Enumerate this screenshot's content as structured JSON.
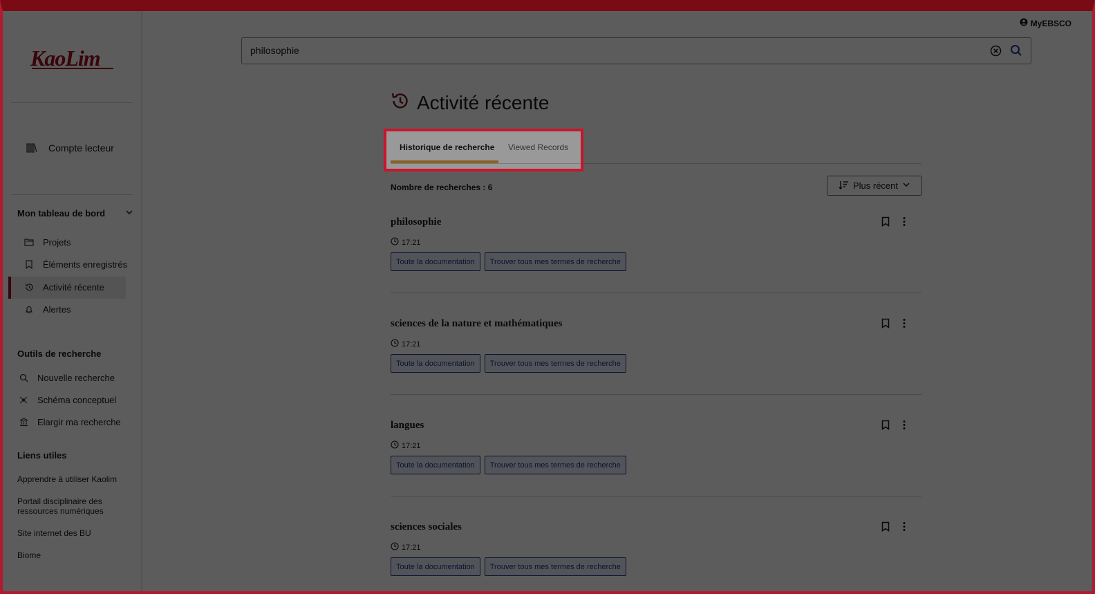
{
  "header": {
    "account_link": "MyEBSCO",
    "search_value": "philosophie"
  },
  "sidebar": {
    "logo_text": "KaoLim",
    "account_label": "Compte lecteur",
    "dashboard": {
      "heading": "Mon tableau de bord",
      "items": [
        {
          "label": "Projets",
          "icon": "folder-icon"
        },
        {
          "label": "Éléments enregistrés",
          "icon": "bookmark-icon"
        },
        {
          "label": "Activité récente",
          "icon": "history-icon"
        },
        {
          "label": "Alertes",
          "icon": "bell-icon"
        }
      ]
    },
    "tools": {
      "heading": "Outils de recherche",
      "items": [
        {
          "label": "Nouvelle recherche",
          "icon": "search-icon"
        },
        {
          "label": "Schéma conceptuel",
          "icon": "concept-map-icon"
        },
        {
          "label": "Elargir ma recherche",
          "icon": "library-icon"
        }
      ]
    },
    "links": {
      "heading": "Liens utiles",
      "items": [
        {
          "label": "Apprendre à utiliser Kaolim"
        },
        {
          "label": "Portail disciplinaire des"
        },
        {
          "label": "ressources numériques"
        },
        {
          "label": "Site internet des BU"
        },
        {
          "label": "Biome"
        }
      ]
    }
  },
  "main": {
    "title": "Activité récente",
    "tabs": [
      {
        "label": "Historique de recherche",
        "active": true
      },
      {
        "label": "Viewed Records",
        "active": false
      }
    ],
    "count_label": "Nombre de recherches : 6",
    "sort_label": "Plus récent",
    "entries": [
      {
        "query": "philosophie",
        "time": "17:21",
        "btn1": "Toute la documentation",
        "btn2": "Trouver tous mes termes de recherche"
      },
      {
        "query": "sciences de la nature et mathématiques",
        "time": "17:21",
        "btn1": "Toute la documentation",
        "btn2": "Trouver tous mes termes de recherche"
      },
      {
        "query": "langues",
        "time": "17:21",
        "btn1": "Toute la documentation",
        "btn2": "Trouver tous mes termes de recherche"
      },
      {
        "query": "sciences sociales",
        "time": "17:21",
        "btn1": "Toute la documentation",
        "btn2": "Trouver tous mes termes de recherche"
      }
    ]
  },
  "colors": {
    "brand": "#a0101e",
    "tab_accent": "#e6a43a",
    "chip": "#1f3a8a"
  }
}
